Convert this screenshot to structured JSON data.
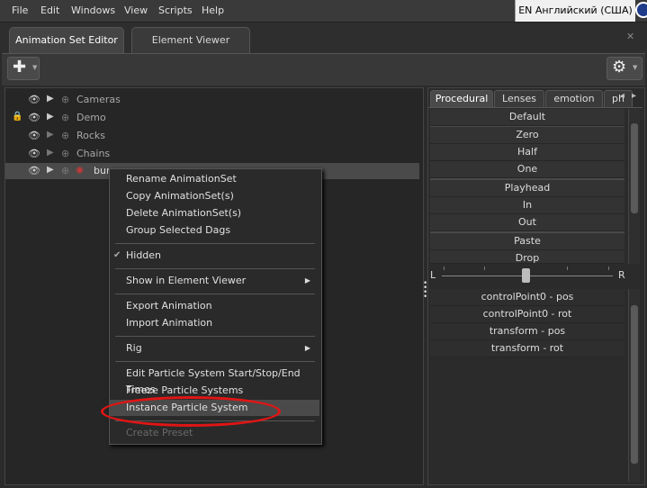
{
  "menubar": {
    "items": [
      "File",
      "Edit",
      "Windows",
      "View",
      "Scripts",
      "Help"
    ],
    "lang": "EN Английский (США)"
  },
  "tabs": [
    {
      "label": "Animation Set Editor",
      "active": true
    },
    {
      "label": "Element Viewer",
      "active": false
    }
  ],
  "tree": [
    {
      "label": "Cameras",
      "locked": false
    },
    {
      "label": "Demo",
      "locked": true
    },
    {
      "label": "Rocks",
      "locked": false
    },
    {
      "label": "Chains",
      "locked": false
    },
    {
      "label": "bur",
      "locked": false,
      "selected": true
    }
  ],
  "right_tabs": [
    "Procedural",
    "Lenses",
    "emotion",
    "ph"
  ],
  "presets": [
    "Default",
    "Zero",
    "Half",
    "One",
    "Playhead",
    "In",
    "Out",
    "Paste",
    "Drop"
  ],
  "slider": {
    "left_label": "L",
    "right_label": "R"
  },
  "controls": [
    "controlPoint0 - pos",
    "controlPoint0 - rot",
    "transform - pos",
    "transform - rot"
  ],
  "context_menu": {
    "items": [
      "Rename AnimationSet",
      "Copy AnimationSet(s)",
      "Delete AnimationSet(s)",
      "Group Selected Dags",
      "Hidden",
      "Show in Element Viewer",
      "Export Animation",
      "Import Animation",
      "Rig",
      "Edit Particle System Start/Stop/End Times",
      "Freeze Particle Systems",
      "Instance Particle System",
      "Create Preset"
    ]
  },
  "colors": {
    "highlight_oval": "#e01515",
    "background": "#2b2b2b"
  },
  "icons": {
    "add": "plus-icon",
    "settings": "gear-icon",
    "close": "close-icon"
  }
}
